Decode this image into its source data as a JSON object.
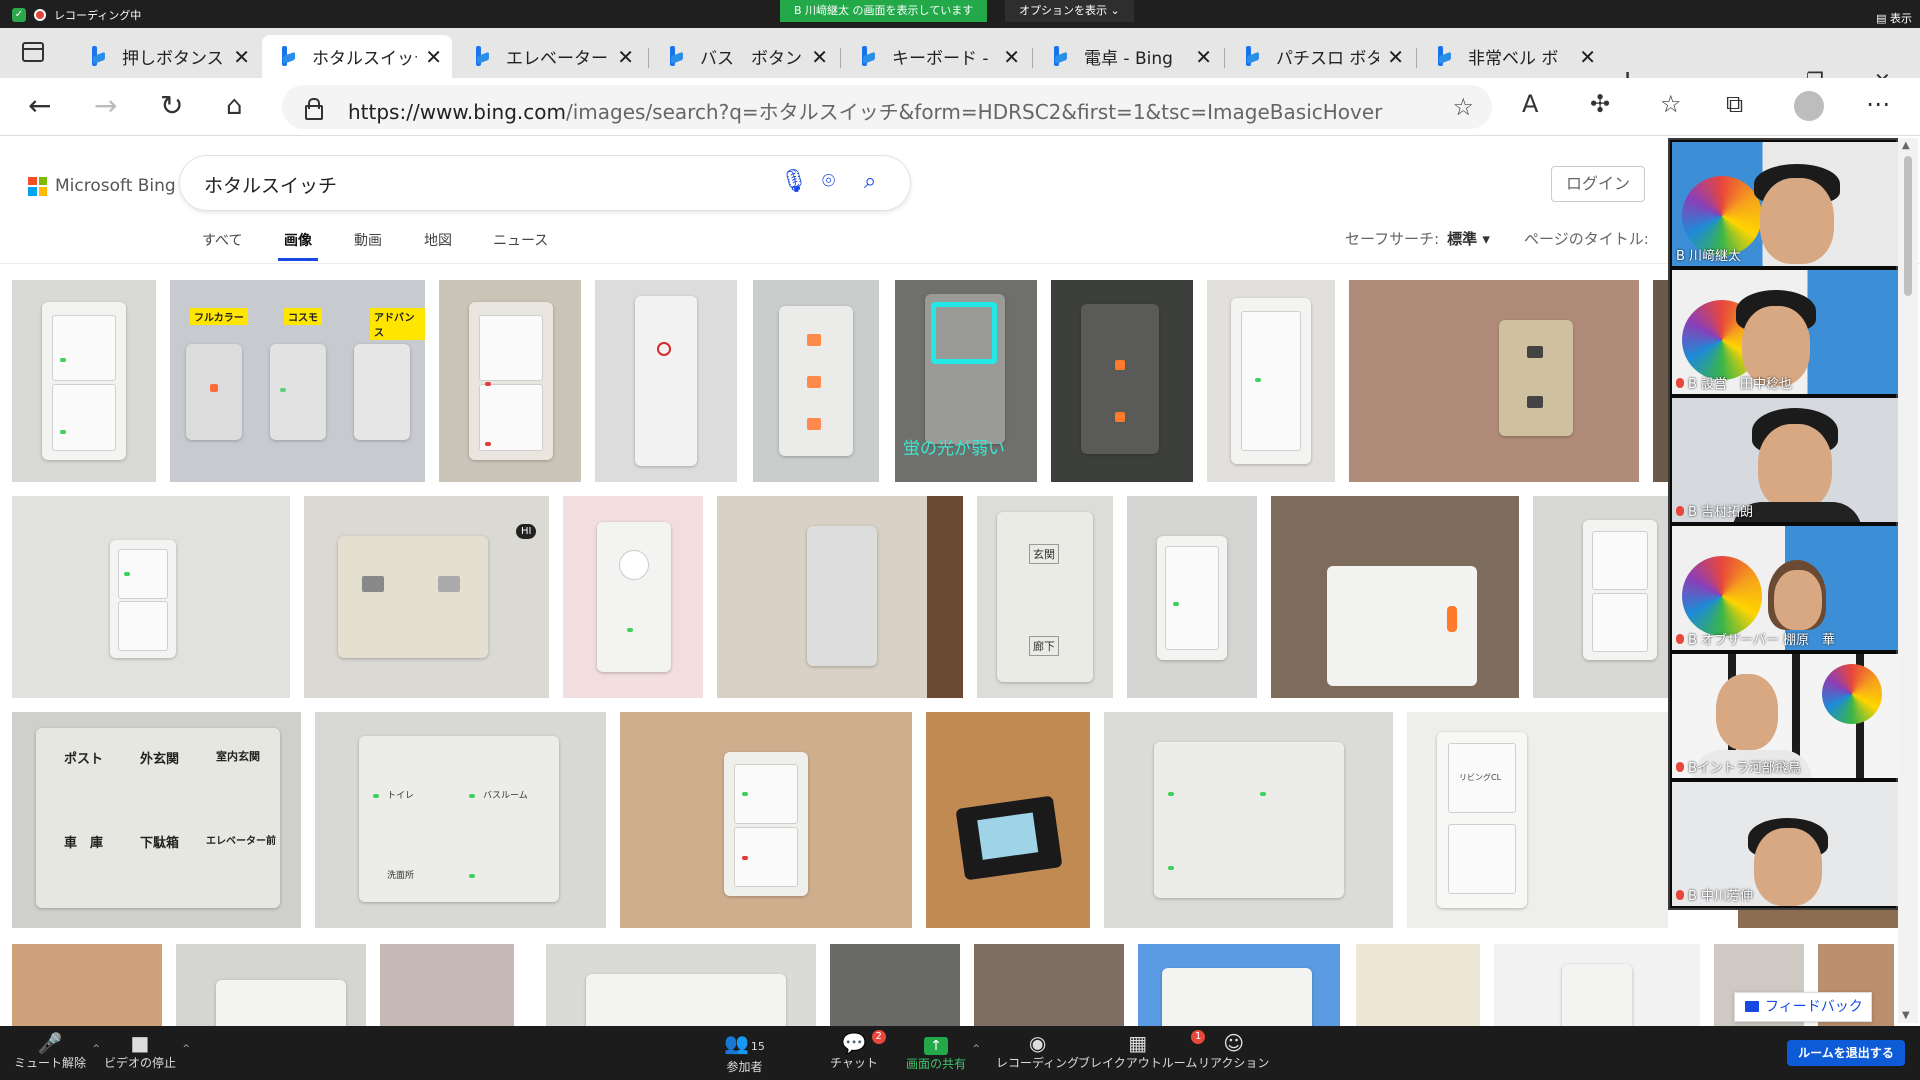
{
  "zoom_top": {
    "recording": "レコーディング中",
    "viewing_banner": "B 川﨑継太 の画面を表示しています",
    "options_label": "オプションを表示 ⌄",
    "show_label": "▤ 表示"
  },
  "browser": {
    "tabs": [
      {
        "label": "押しボタンス・"
      },
      {
        "label": "ホタルスイッチ"
      },
      {
        "label": "エレベーター"
      },
      {
        "label": "バス　ボタン"
      },
      {
        "label": "キーボード - B"
      },
      {
        "label": "電卓 - Bing"
      },
      {
        "label": "パチスロ ボタ"
      },
      {
        "label": "非常ベル ボ"
      }
    ],
    "url_host": "https://www.bing.com",
    "url_rest": "/images/search?q=ホタルスイッチ&form=HDRSC2&first=1&tsc=ImageBasicHover"
  },
  "bing": {
    "brand": "Microsoft Bing",
    "query": "ホタルスイッチ",
    "login": "ログイン",
    "nav": [
      "すべて",
      "画像",
      "動画",
      "地図",
      "ニュース"
    ],
    "safe_search_label": "セーフサーチ:",
    "safe_search_value": "標準 ▾",
    "page_title_label": "ページのタイトル:",
    "thumb_labels": {
      "full_color": "フルカラー",
      "cosmo": "コスモ",
      "advance": "アドバンス",
      "firefly_weak": "蛍の光が弱い",
      "hi": "HI",
      "entrance": "玄関",
      "hallway": "廊下",
      "post": "ポスト",
      "outer_entrance": "外玄関",
      "inner_entrance": "室内玄関",
      "garage": "車　庫",
      "shoe_box": "下駄箱",
      "elevator": "エレベーター前",
      "toilet": "トイレ",
      "bathroom": "バスルーム",
      "washroom": "洗面所",
      "living": "リビングCL"
    },
    "feedback": "フィードバック"
  },
  "participants": [
    {
      "name": "B 川﨑継太"
    },
    {
      "name": "B 設営　田中稔也"
    },
    {
      "name": "B 吉村拓朗"
    },
    {
      "name": "B オブザーバー 棚原　華"
    },
    {
      "name": "Bイントラ河部飛鳥"
    },
    {
      "name": "B 中川芳伸"
    }
  ],
  "zoom_bar": {
    "mute": "ミュート解除",
    "video": "ビデオの停止",
    "participants": "参加者",
    "participants_count": "15",
    "chat": "チャット",
    "chat_badge": "2",
    "share": "画面の共有",
    "record": "レコーディング",
    "breakout": "ブレイクアウトルーム",
    "breakout_badge": "1",
    "reactions": "リアクション",
    "leave": "ルームを退出する"
  }
}
